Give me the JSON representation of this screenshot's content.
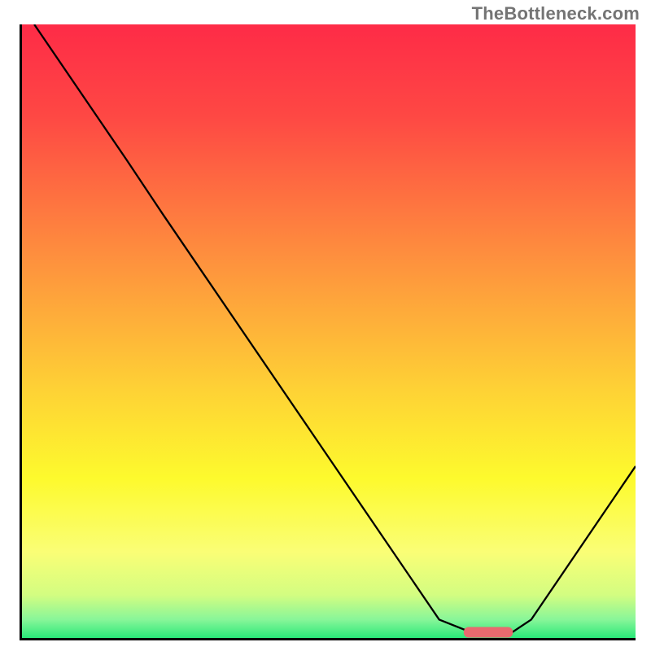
{
  "watermark": "TheBottleneck.com",
  "chart_data": {
    "type": "line",
    "title": "",
    "xlabel": "",
    "ylabel": "",
    "xlim": [
      0,
      100
    ],
    "ylim": [
      0,
      100
    ],
    "grid": false,
    "legend": false,
    "series": [
      {
        "name": "bottleneck-curve",
        "points": [
          {
            "x": 2,
            "y": 100
          },
          {
            "x": 17,
            "y": 78
          },
          {
            "x": 23,
            "y": 69
          },
          {
            "x": 68,
            "y": 3
          },
          {
            "x": 73,
            "y": 1
          },
          {
            "x": 80,
            "y": 1
          },
          {
            "x": 83,
            "y": 3
          },
          {
            "x": 100,
            "y": 28
          }
        ]
      }
    ],
    "annotations": [
      {
        "name": "optimal-marker",
        "shape": "rounded-bar",
        "color": "#e86a6f",
        "x_start": 72,
        "x_end": 80,
        "y": 1
      }
    ],
    "background_gradient": {
      "stops": [
        {
          "offset": 0.0,
          "color": "#fe2b47"
        },
        {
          "offset": 0.15,
          "color": "#fe4844"
        },
        {
          "offset": 0.4,
          "color": "#fe963d"
        },
        {
          "offset": 0.6,
          "color": "#fed335"
        },
        {
          "offset": 0.74,
          "color": "#fdfa2d"
        },
        {
          "offset": 0.86,
          "color": "#fafe76"
        },
        {
          "offset": 0.93,
          "color": "#d3fd81"
        },
        {
          "offset": 0.97,
          "color": "#88f699"
        },
        {
          "offset": 1.0,
          "color": "#2ae879"
        }
      ]
    }
  }
}
